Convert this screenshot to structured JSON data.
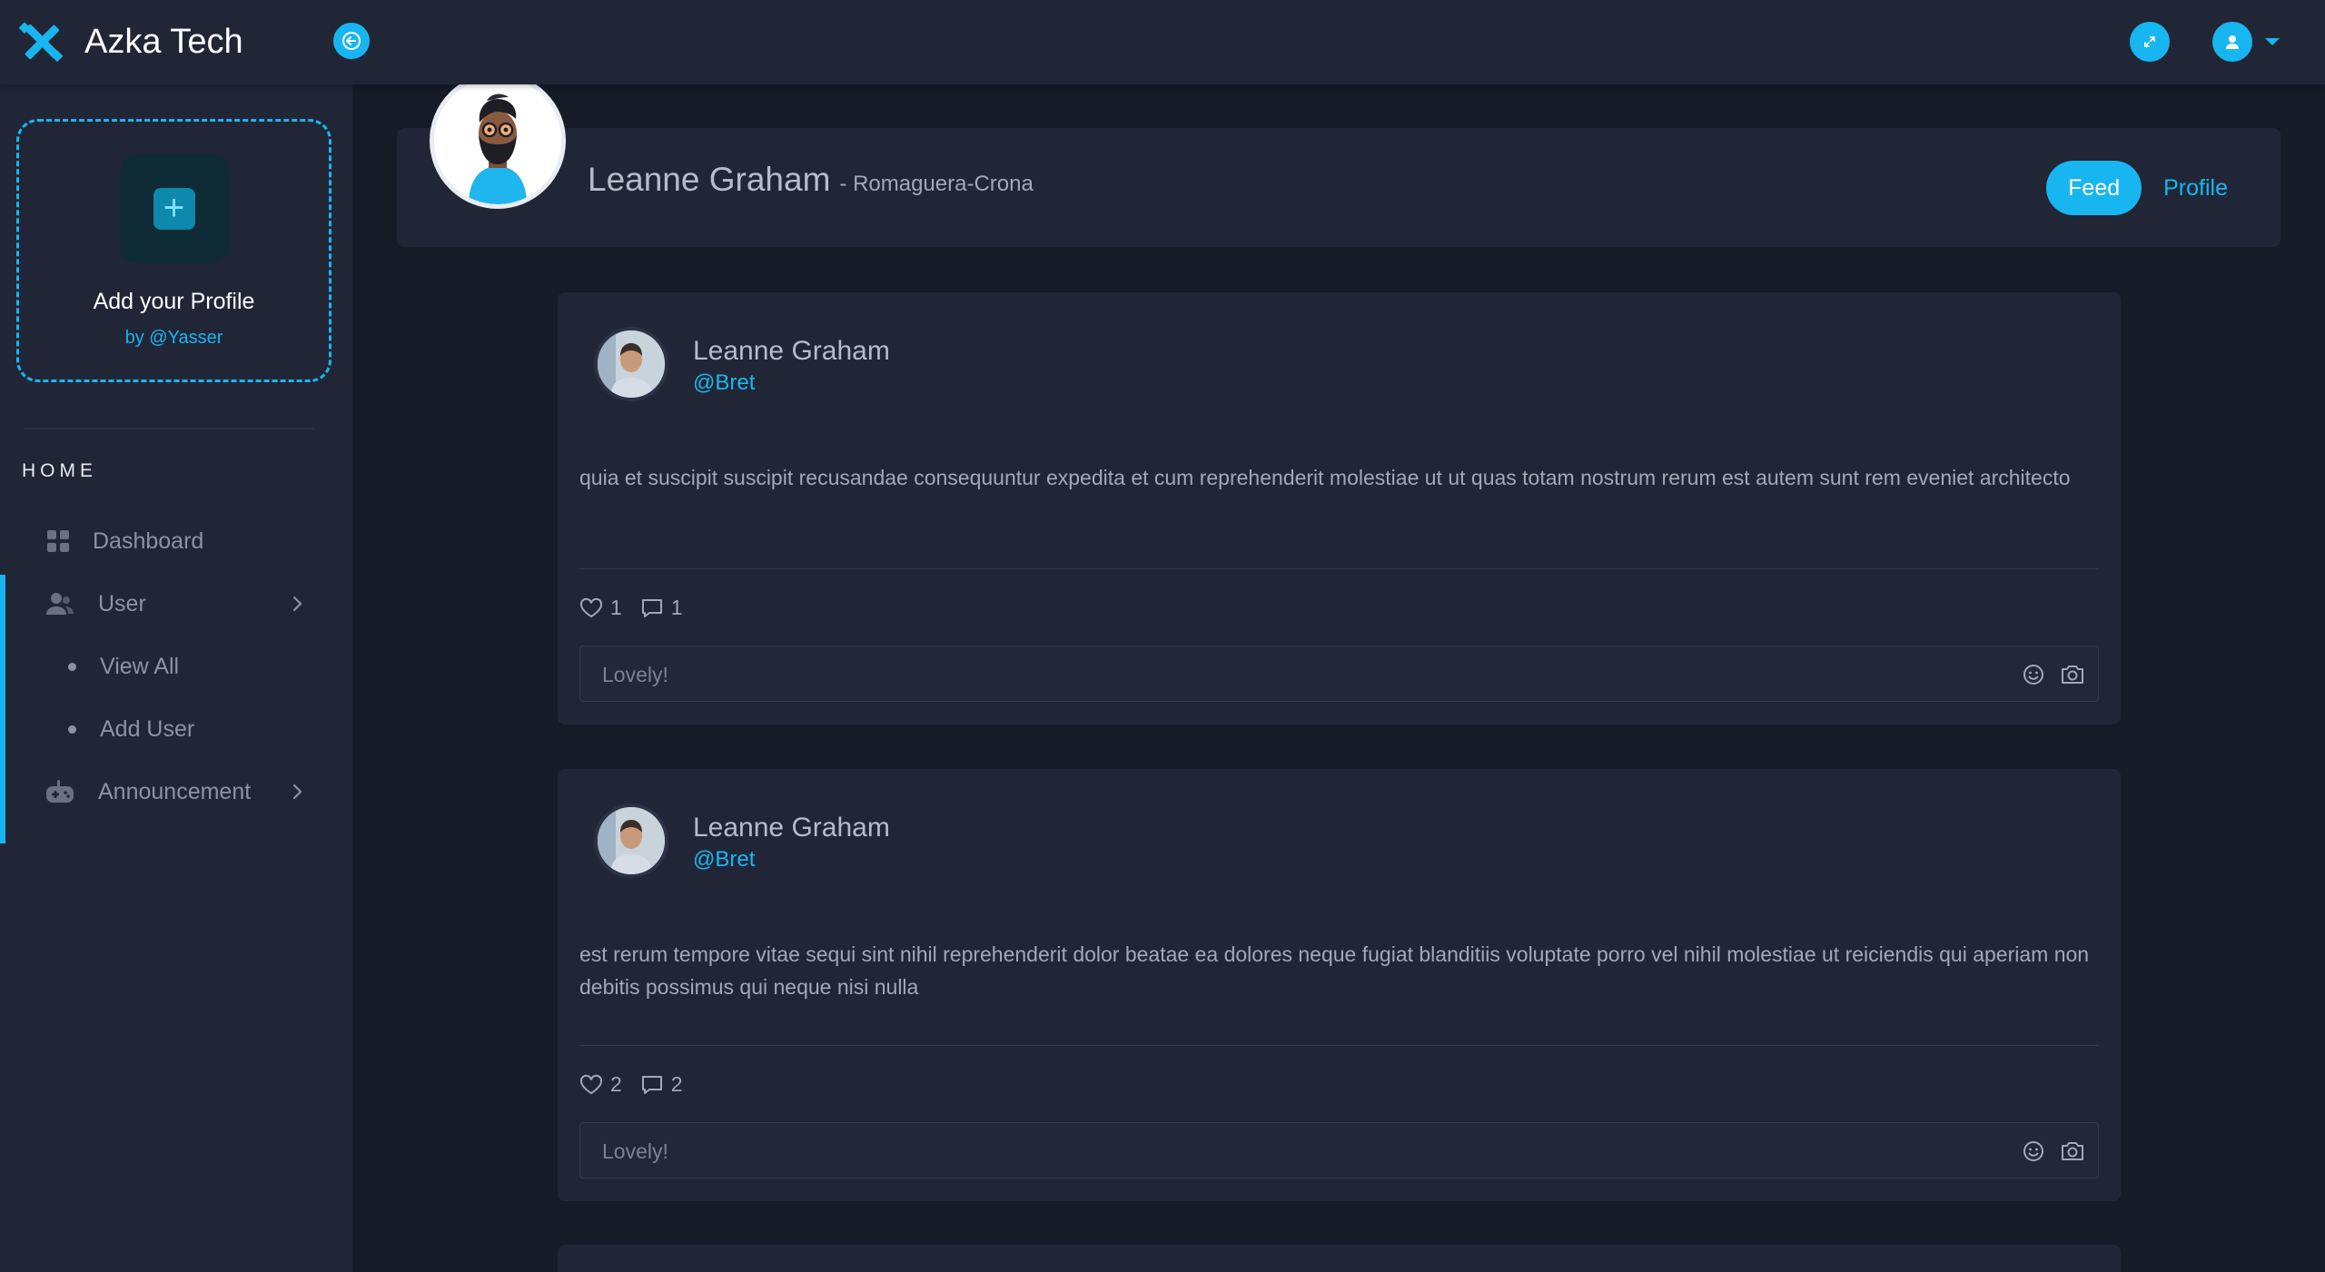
{
  "app": {
    "name": "Azka Tech",
    "accent": "#18b6f0"
  },
  "topbar": {
    "collapse_icon": "arrow-left-icon",
    "fullscreen_icon": "expand-icon",
    "user_icon": "user-icon"
  },
  "sidebar": {
    "add_profile": {
      "title": "Add your Profile",
      "byline": "by @Yasser"
    },
    "section": "HOME",
    "items": [
      {
        "label": "Dashboard",
        "icon": "grid-icon"
      },
      {
        "label": "User",
        "icon": "users-icon"
      },
      {
        "label": "View All"
      },
      {
        "label": "Add User"
      },
      {
        "label": "Announcement",
        "icon": "gamepad-icon"
      }
    ]
  },
  "profile": {
    "name": "Leanne Graham",
    "company": "- Romaguera-Crona",
    "tabs": {
      "feed": "Feed",
      "profile": "Profile"
    }
  },
  "posts": [
    {
      "author": "Leanne Graham",
      "handle": "@Bret",
      "body": "quia et suscipit suscipit recusandae consequuntur expedita et cum reprehenderit molestiae ut ut quas totam nostrum rerum est autem sunt rem eveniet architecto",
      "likes": "1",
      "comments": "1",
      "comment_placeholder": "Lovely!"
    },
    {
      "author": "Leanne Graham",
      "handle": "@Bret",
      "body": "est rerum tempore vitae sequi sint nihil reprehenderit dolor beatae ea dolores neque fugiat blanditiis voluptate porro vel nihil molestiae ut reiciendis qui aperiam non debitis possimus qui neque nisi nulla",
      "likes": "2",
      "comments": "2",
      "comment_placeholder": "Lovely!"
    }
  ]
}
